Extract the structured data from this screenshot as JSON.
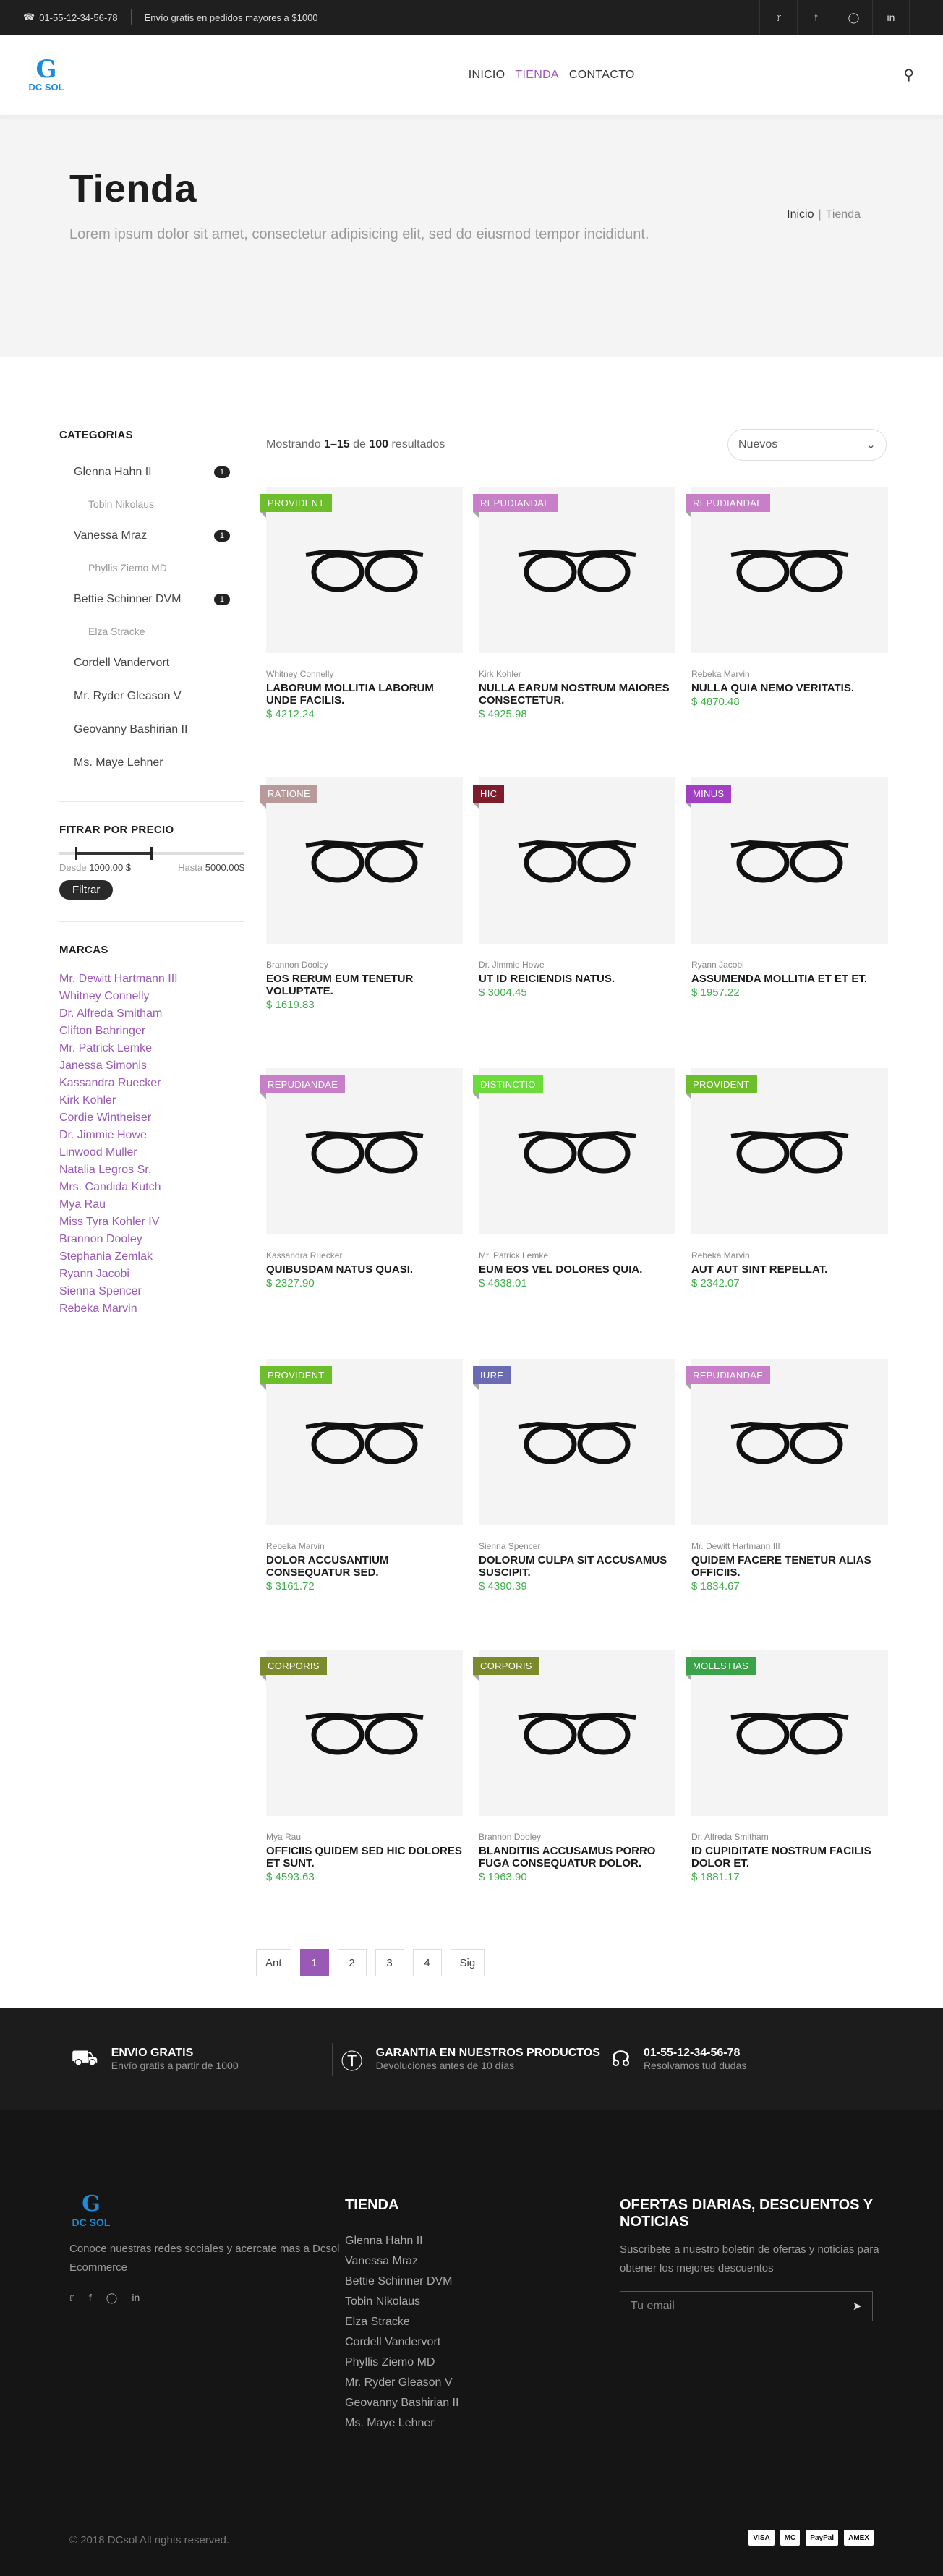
{
  "topbar": {
    "phone": "01-55-12-34-56-78",
    "shipping": "Envío gratis en pedidos mayores a $1000",
    "social": [
      "twitter-icon",
      "facebook-icon",
      "instagram-icon",
      "linkedin-icon"
    ]
  },
  "header": {
    "logo": "DC SOL",
    "nav": [
      "INICIO",
      "TIENDA",
      "CONTACTO"
    ]
  },
  "hero": {
    "title": "Tienda",
    "subtitle": "Lorem ipsum dolor sit amet, consectetur adipisicing elit, sed do eiusmod tempor incididunt.",
    "breadcrumb": [
      "Inicio",
      "Tienda"
    ]
  },
  "sidebar": {
    "categories_title": "CATEGORIAS",
    "categories": [
      {
        "label": "Glenna Hahn II",
        "count": "1",
        "sub": false
      },
      {
        "label": "Tobin Nikolaus",
        "count": "",
        "sub": true
      },
      {
        "label": "Vanessa Mraz",
        "count": "1",
        "sub": false
      },
      {
        "label": "Phyllis Ziemo MD",
        "count": "",
        "sub": true
      },
      {
        "label": "Bettie Schinner DVM",
        "count": "1",
        "sub": false
      },
      {
        "label": "Elza Stracke",
        "count": "",
        "sub": true
      },
      {
        "label": "Cordell Vandervort",
        "count": "",
        "sub": false
      },
      {
        "label": "Mr. Ryder Gleason V",
        "count": "",
        "sub": false
      },
      {
        "label": "Geovanny Bashirian II",
        "count": "",
        "sub": false
      },
      {
        "label": "Ms. Maye Lehner",
        "count": "",
        "sub": false
      }
    ],
    "price_title": "FITRAR POR PRECIO",
    "price": {
      "from_label": "Desde",
      "from": "1000.00 $",
      "to_label": "Hasta",
      "to": "5000.00$",
      "button": "Filtrar"
    },
    "brands_title": "MARCAS",
    "brands": [
      "Mr. Dewitt Hartmann III",
      "Whitney Connelly",
      "Dr. Alfreda Smitham",
      "Clifton Bahringer",
      "Mr. Patrick Lemke",
      "Janessa Simonis",
      "Kassandra Ruecker",
      "Kirk Kohler",
      "Cordie Wintheiser",
      "Dr. Jimmie Howe",
      "Linwood Muller",
      "Natalia Legros Sr.",
      "Mrs. Candida Kutch",
      "Mya Rau",
      "Miss Tyra Kohler IV",
      "Brannon Dooley",
      "Stephania Zemlak",
      "Ryann Jacobi",
      "Sienna Spencer",
      "Rebeka Marvin"
    ]
  },
  "toolbar": {
    "showing_pre": "Mostrando ",
    "showing_range": "1–15",
    "showing_mid": " de ",
    "showing_total": "100",
    "showing_post": " resultados",
    "sort": "Nuevos"
  },
  "products": [
    {
      "tag": "PROVIDENT",
      "tag_color": "#6cbf2a",
      "brand": "Whitney Connelly",
      "title": "Laborum mollitia laborum unde facilis.",
      "price": "$ 4212.24"
    },
    {
      "tag": "REPUDIANDAE",
      "tag_color": "#c77fc7",
      "brand": "Kirk Kohler",
      "title": "Nulla earum nostrum maiores consectetur.",
      "price": "$ 4925.98"
    },
    {
      "tag": "REPUDIANDAE",
      "tag_color": "#c77fc7",
      "brand": "Rebeka Marvin",
      "title": "Nulla quia nemo veritatis.",
      "price": "$ 4870.48"
    },
    {
      "tag": "RATIONE",
      "tag_color": "#b89a9a",
      "brand": "Brannon Dooley",
      "title": "Eos rerum eum tenetur voluptate.",
      "price": "$ 1619.83"
    },
    {
      "tag": "HIC",
      "tag_color": "#7d1d2b",
      "brand": "Dr. Jimmie Howe",
      "title": "Ut id reiciendis natus.",
      "price": "$ 3004.45"
    },
    {
      "tag": "MINUS",
      "tag_color": "#a23fc4",
      "brand": "Ryann Jacobi",
      "title": "Assumenda mollitia et et et.",
      "price": "$ 1957.22"
    },
    {
      "tag": "REPUDIANDAE",
      "tag_color": "#c77fc7",
      "brand": "Kassandra Ruecker",
      "title": "Quibusdam natus quasi.",
      "price": "$ 2327.90"
    },
    {
      "tag": "DISTINCTIO",
      "tag_color": "#6bdc3a",
      "brand": "Mr. Patrick Lemke",
      "title": "Eum eos vel dolores quia.",
      "price": "$ 4638.01"
    },
    {
      "tag": "PROVIDENT",
      "tag_color": "#6cbf2a",
      "brand": "Rebeka Marvin",
      "title": "Aut aut sint repellat.",
      "price": "$ 2342.07"
    },
    {
      "tag": "PROVIDENT",
      "tag_color": "#6cbf2a",
      "brand": "Rebeka Marvin",
      "title": "Dolor accusantium consequatur sed.",
      "price": "$ 3161.72"
    },
    {
      "tag": "IURE",
      "tag_color": "#6a6bb2",
      "brand": "Sienna Spencer",
      "title": "Dolorum culpa sit accusamus suscipit.",
      "price": "$ 4390.39"
    },
    {
      "tag": "REPUDIANDAE",
      "tag_color": "#c77fc7",
      "brand": "Mr. Dewitt Hartmann III",
      "title": "Quidem facere tenetur alias officiis.",
      "price": "$ 1834.67"
    },
    {
      "tag": "CORPORIS",
      "tag_color": "#7c8a2b",
      "brand": "Mya Rau",
      "title": "Officiis quidem sed hic dolores et sunt.",
      "price": "$ 4593.63"
    },
    {
      "tag": "CORPORIS",
      "tag_color": "#7c8a2b",
      "brand": "Brannon Dooley",
      "title": "Blanditiis accusamus porro fuga consequatur dolor.",
      "price": "$ 1963.90"
    },
    {
      "tag": "MOLESTIAS",
      "tag_color": "#3aa34a",
      "brand": "Dr. Alfreda Smitham",
      "title": "Id cupiditate nostrum facilis dolor et.",
      "price": "$ 1881.17"
    }
  ],
  "pager": [
    "Ant",
    "1",
    "2",
    "3",
    "4",
    "Sig"
  ],
  "features": [
    {
      "icon": "truck-icon",
      "title": "ENVIO GRATIS",
      "text": "Envío gratis a partir de 1000"
    },
    {
      "icon": "dollar-icon",
      "title": "GARANTIA EN NUESTROS PRODUCTOS",
      "text": "Devoluciones antes de 10 días"
    },
    {
      "icon": "headphones-icon",
      "title": "01-55-12-34-56-78",
      "text": "Resolvamos tud dudas"
    }
  ],
  "footer": {
    "about": "Conoce nuestras redes sociales y acercate mas a Dcsol Ecommerce",
    "shop_title": "TIENDA",
    "shop_links": [
      "Glenna Hahn II",
      "Vanessa Mraz",
      "Bettie Schinner DVM",
      "Tobin Nikolaus",
      "Elza Stracke",
      "Cordell Vandervort",
      "Phyllis Ziemo MD",
      "Mr. Ryder Gleason V",
      "Geovanny Bashirian II",
      "Ms. Maye Lehner"
    ],
    "offers_title": "OFERTAS DIARIAS, DESCUENTOS Y NOTICIAS",
    "offers_text": "Suscribete a nuestro boletín de ofertas y noticias para obtener los mejores descuentos",
    "email_placeholder": "Tu email",
    "copyright": "© 2018 DCsol All rights reserved.",
    "payments": [
      "VISA",
      "MC",
      "PayPal",
      "AMEX"
    ]
  }
}
